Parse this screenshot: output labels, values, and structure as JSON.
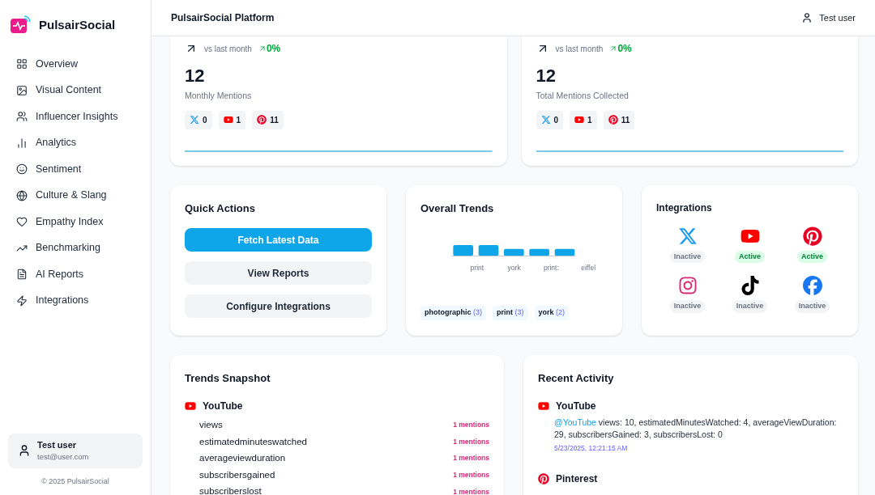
{
  "brand": "PulsairSocial",
  "nav": [
    {
      "label": "Overview",
      "selected": false
    },
    {
      "label": "Visual Content",
      "selected": false
    },
    {
      "label": "Influencer Insights",
      "selected": false
    },
    {
      "label": "Analytics",
      "selected": false
    },
    {
      "label": "Sentiment",
      "selected": false
    },
    {
      "label": "Culture & Slang",
      "selected": false
    },
    {
      "label": "Empathy Index",
      "selected": false
    },
    {
      "label": "Benchmarking",
      "selected": false
    },
    {
      "label": "AI Reports",
      "selected": false
    },
    {
      "label": "Integrations",
      "selected": false
    }
  ],
  "user": {
    "name": "Test user",
    "email": "test@user.com"
  },
  "footer": "© 2025 PulsairSocial",
  "header": {
    "title": "PulsairSocial Platform",
    "user": "Test user"
  },
  "stat_cards": [
    {
      "comparison": "vs last month",
      "change": "0%",
      "value": "12",
      "label": "Monthly Mentions",
      "platforms": [
        {
          "kind": "x",
          "count": "0"
        },
        {
          "kind": "youtube",
          "count": "1"
        },
        {
          "kind": "pinterest",
          "count": "11"
        }
      ]
    },
    {
      "comparison": "vs last month",
      "change": "0%",
      "value": "12",
      "label": "Total Mentions Collected",
      "platforms": [
        {
          "kind": "x",
          "count": "0"
        },
        {
          "kind": "youtube",
          "count": "1"
        },
        {
          "kind": "pinterest",
          "count": "11"
        }
      ]
    }
  ],
  "quick_actions": {
    "title": "Quick Actions",
    "buttons": [
      {
        "label": "Fetch Latest Data",
        "primary": true
      },
      {
        "label": "View Reports",
        "primary": false
      },
      {
        "label": "Configure Integrations",
        "primary": false
      }
    ]
  },
  "overall_trends": {
    "title": "Overall Trends",
    "axis_labels": [
      "print",
      "york",
      "print:",
      "eiffel"
    ],
    "tags": [
      {
        "label": "photographic",
        "count": "(3)"
      },
      {
        "label": "print",
        "count": "(3)"
      },
      {
        "label": "york",
        "count": "(2)"
      }
    ]
  },
  "integrations": {
    "title": "Integrations",
    "items": [
      {
        "kind": "x",
        "status": "Inactive",
        "active": false
      },
      {
        "kind": "youtube",
        "status": "Active",
        "active": true
      },
      {
        "kind": "pinterest",
        "status": "Active",
        "active": true
      },
      {
        "kind": "instagram",
        "status": "Inactive",
        "active": false
      },
      {
        "kind": "tiktok",
        "status": "Inactive",
        "active": false
      },
      {
        "kind": "facebook",
        "status": "Inactive",
        "active": false
      }
    ]
  },
  "trends_snapshot": {
    "title": "Trends Snapshot",
    "groups": [
      {
        "kind": "youtube",
        "name": "YouTube",
        "rows": [
          {
            "term": "views",
            "count": "1 mentions"
          },
          {
            "term": "estimatedminuteswatched",
            "count": "1 mentions"
          },
          {
            "term": "averageviewduration",
            "count": "1 mentions"
          },
          {
            "term": "subscribersgained",
            "count": "1 mentions"
          },
          {
            "term": "subscriberslost",
            "count": "1 mentions"
          }
        ]
      }
    ]
  },
  "recent_activity": {
    "title": "Recent Activity",
    "items": [
      {
        "kind": "youtube",
        "name": "YouTube",
        "handle": "@YouTube",
        "text": "views: 10, estimatedMinutesWatched: 4, averageViewDuration: 29, subscribersGained: 3, subscribersLost: 0",
        "time": "5/23/2025, 12:21:15 AM"
      },
      {
        "kind": "pinterest",
        "name": "Pinterest"
      }
    ]
  }
}
